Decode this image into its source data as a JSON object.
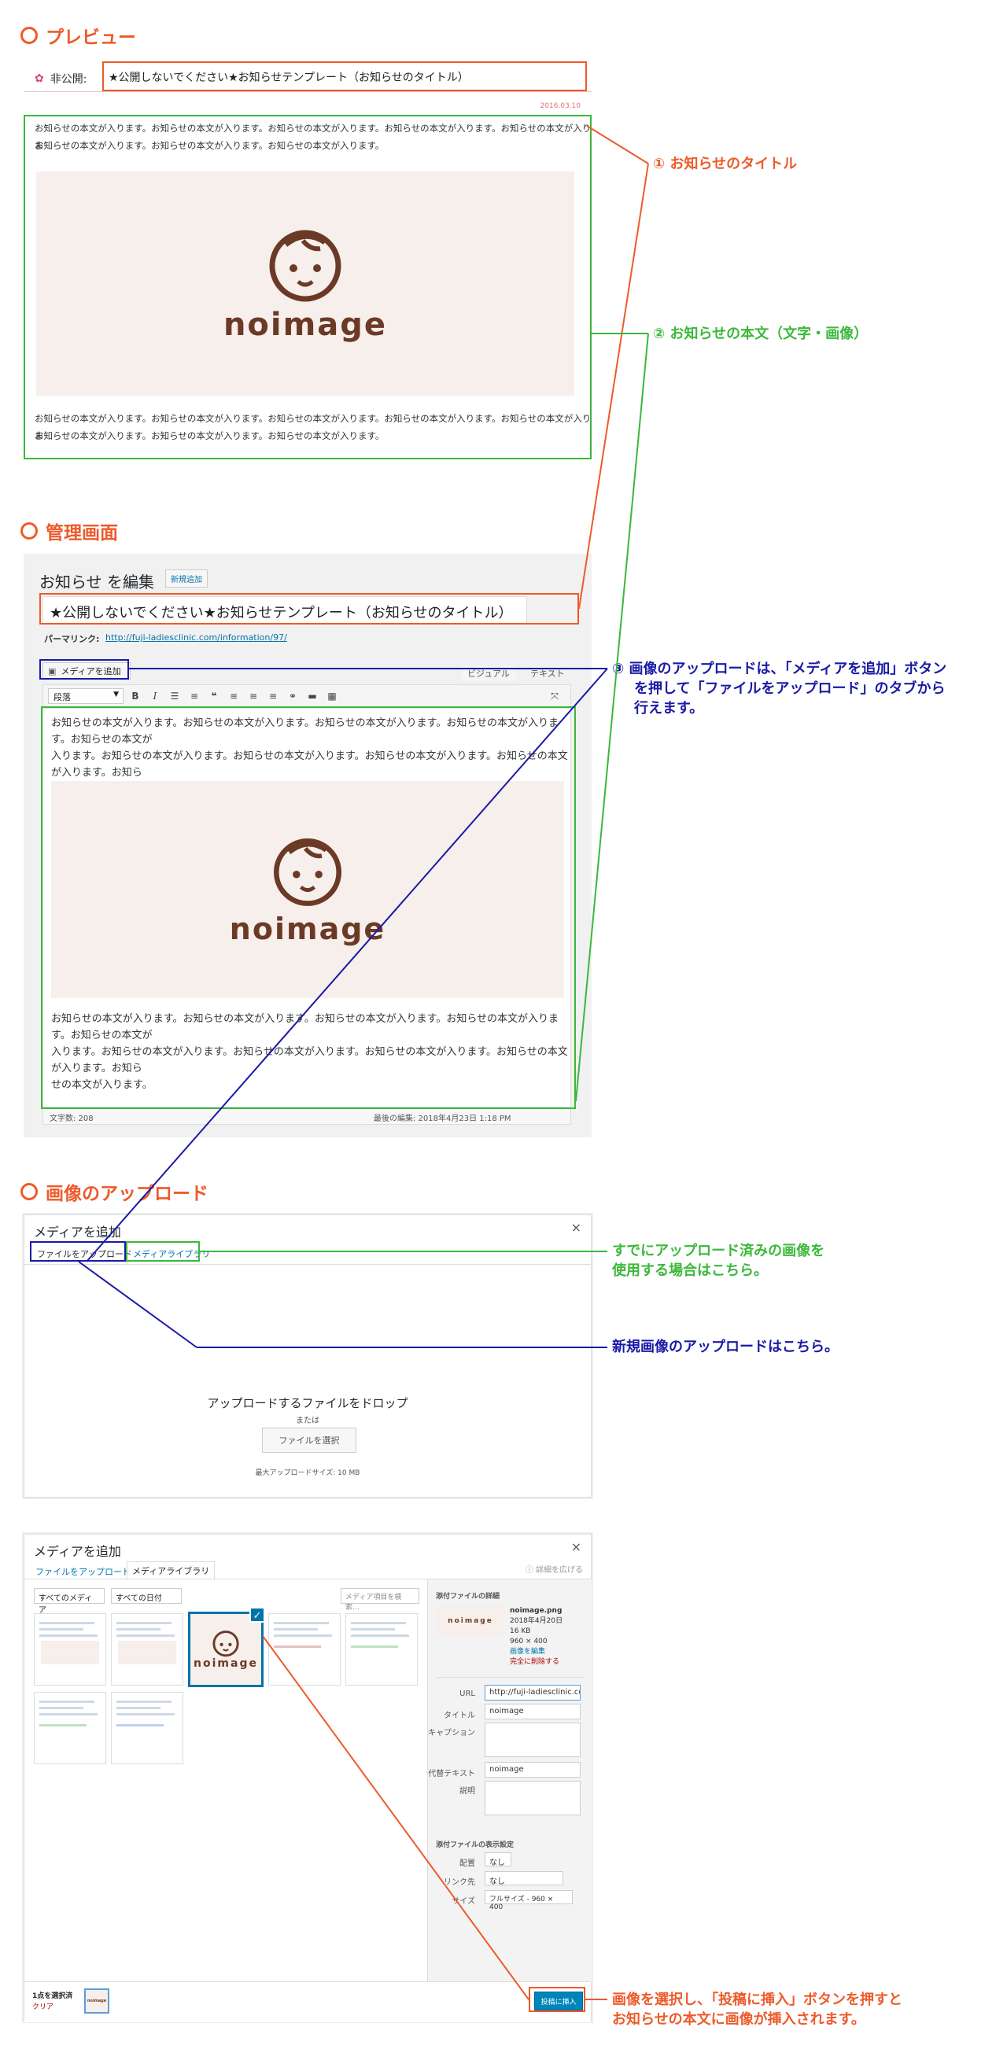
{
  "sections": {
    "preview": "プレビュー",
    "admin": "管理画面",
    "upload": "画像のアップロード"
  },
  "preview": {
    "status_label": "非公開:",
    "post_title": "★公開しないでください★お知らせテンプレート（お知らせのタイトル）",
    "date": "2016.03.10",
    "body_line1": "お知らせの本文が入ります。お知らせの本文が入ります。お知らせの本文が入ります。お知らせの本文が入ります。お知らせの本文が入りま",
    "body_line2": "お知らせの本文が入ります。お知らせの本文が入ります。お知らせの本文が入ります。",
    "noimage_word": "noimage"
  },
  "annotations": {
    "a1": "① お知らせのタイトル",
    "a2": "② お知らせの本文（文字・画像）",
    "a3_l1": "③ 画像のアップロードは、「メディアを追加」ボタン",
    "a3_l2": "を押して「ファイルをアップロード」のタブから",
    "a3_l3": "行えます。",
    "library_l1": "すでにアップロード済みの画像を",
    "library_l2": "使用する場合はこちら。",
    "new_upload": "新規画像のアップロードはこちら。",
    "insert_l1": "画像を選択し、「投稿に挿入」ボタンを押すと",
    "insert_l2": "お知らせの本文に画像が挿入されます。"
  },
  "editor": {
    "heading": "お知らせ を編集",
    "new_button": "新規追加",
    "title_value": "★公開しないでください★お知らせテンプレート（お知らせのタイトル）",
    "permalink_label": "パーマリンク:",
    "permalink_url": "http://fuji-ladiesclinic.com/information/97/",
    "add_media": "メディアを追加",
    "tab_visual": "ビジュアル",
    "tab_text": "テキスト",
    "format_select": "段落",
    "body_p1_l1": "お知らせの本文が入ります。お知らせの本文が入ります。お知らせの本文が入ります。お知らせの本文が入ります。お知らせの本文が",
    "body_p1_l2": "入ります。お知らせの本文が入ります。お知らせの本文が入ります。お知らせの本文が入ります。お知らせの本文が入ります。お知ら",
    "body_p1_l3": "せの本文が入ります。",
    "word_count": "文字数: 208",
    "last_edit": "最後の編集: 2018年4月23日 1:18 PM"
  },
  "upload_modal": {
    "title": "メディアを追加",
    "close": "×",
    "tab_upload": "ファイルをアップロード",
    "tab_library": "メディアライブラリ",
    "drop_text": "アップロードするファイルをドロップ",
    "or": "または",
    "select_button": "ファイルを選択",
    "max_size": "最大アップロードサイズ: 10 MB"
  },
  "library_modal": {
    "title": "メディアを追加",
    "close": "×",
    "tab_upload": "ファイルをアップロード",
    "tab_library": "メディアライブラリ",
    "expand": "詳細を広げる",
    "filter_type": "すべてのメディア",
    "filter_date": "すべての日付",
    "search_placeholder": "メディア項目を検索...",
    "details_heading": "添付ファイルの詳細",
    "filename": "noimage.png",
    "file_date": "2018年4月20日",
    "file_size": "16 KB",
    "dimensions": "960 × 400",
    "edit_image": "画像を編集",
    "delete": "完全に削除する",
    "url_label": "URL",
    "url_value": "http://fuji-ladiesclinic.com/",
    "title_label": "タイトル",
    "title_value": "noimage",
    "caption_label": "キャプション",
    "alt_label": "代替テキスト",
    "alt_value": "noimage",
    "desc_label": "説明",
    "display_heading": "添付ファイルの表示設定",
    "align_label": "配置",
    "align_value": "なし",
    "link_label": "リンク先",
    "link_value": "なし",
    "size_label": "サイズ",
    "size_value": "フルサイズ - 960 × 400",
    "selected_count": "1点を選択済",
    "clear": "クリア",
    "insert_button": "投稿に挿入",
    "noimage_word": "noimage",
    "check": "✓"
  },
  "colors": {
    "orange": "#ee5a2a",
    "green": "#3bb83b",
    "blue": "#1a1aa6",
    "wp_blue": "#0073aa"
  }
}
